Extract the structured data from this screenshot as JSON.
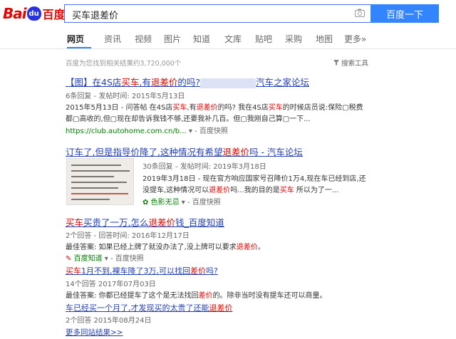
{
  "header": {
    "logo": {
      "bai": "Bai",
      "paw": "du",
      "du": "百度"
    },
    "search_value": "买车退差价",
    "search_button": "百度一下"
  },
  "tabs": [
    "网页",
    "资讯",
    "视频",
    "图片",
    "知道",
    "文库",
    "贴吧",
    "采购",
    "地图",
    "更多»"
  ],
  "result_count": "百度为您找到相关结果约3,720,000个",
  "search_tools": "搜索工具",
  "results": [
    {
      "title_parts": [
        "【图】在4S店",
        "买车",
        ",有",
        "退差价",
        "的吗?",
        "汽车之家论坛"
      ],
      "meta": "6条回复 - 发帖时间: 2015年5月13日",
      "snippet1_parts": [
        "2015年5月13日 - 问答帖 在4S店",
        "买车",
        ",有",
        "退差价",
        "的吗? 我在4S店",
        "买车",
        "的时候店员说:保险▢税费"
      ],
      "snippet2": "都▢高收的,但▢现在却告诉我钱不够,还要我补几百。但▢我刚自己算▢一下...",
      "url": "https://club.autohome.com.cn/b...",
      "cache": "百度快照"
    },
    {
      "title_parts": [
        "订车了,但是指导价降了,这种情况有希望",
        "退差价",
        "吗 - 汽车论坛"
      ],
      "meta": "30条回复 - 发帖时间: 2019年3月18日",
      "snippet1": "2019年3月18日 - 现在官方响应国家号召降价1万4,现在车已经到店,还",
      "snippet2_parts": [
        "没提车,这种情况可以",
        "退差价",
        "吗...我的目的是",
        "买车",
        " 所以为了一..."
      ],
      "url": "色影无忌",
      "cache": "百度快照"
    },
    {
      "title_parts": [
        "买车",
        "买贵了一万,怎么",
        "退差价",
        "钱_百度知道"
      ],
      "meta": "2个回答 - 回答时间: 2016年12月17日",
      "snippet_parts": [
        "最佳答案: 如果已经上牌了就没办法了,没上牌可以要求",
        "退差价",
        "。"
      ],
      "url": "百度知道",
      "cache": "百度快照"
    },
    {
      "title_parts": [
        "买车",
        "1月不到,裸车降了3万,可以找回",
        "差价",
        "吗?"
      ],
      "meta": "14个回答   2017年07月03日",
      "snippet_parts": [
        "最佳答案: 你都已经提车了这个是无法找回",
        "差价",
        "的。除非当时没有提车还可以商量。"
      ]
    },
    {
      "title_parts": [
        "车已经买一个月了,才发现买的太贵了还能",
        "退差价"
      ],
      "meta": "2个回答   2015年08月24日"
    }
  ],
  "more_results": "更多同站结果>>"
}
